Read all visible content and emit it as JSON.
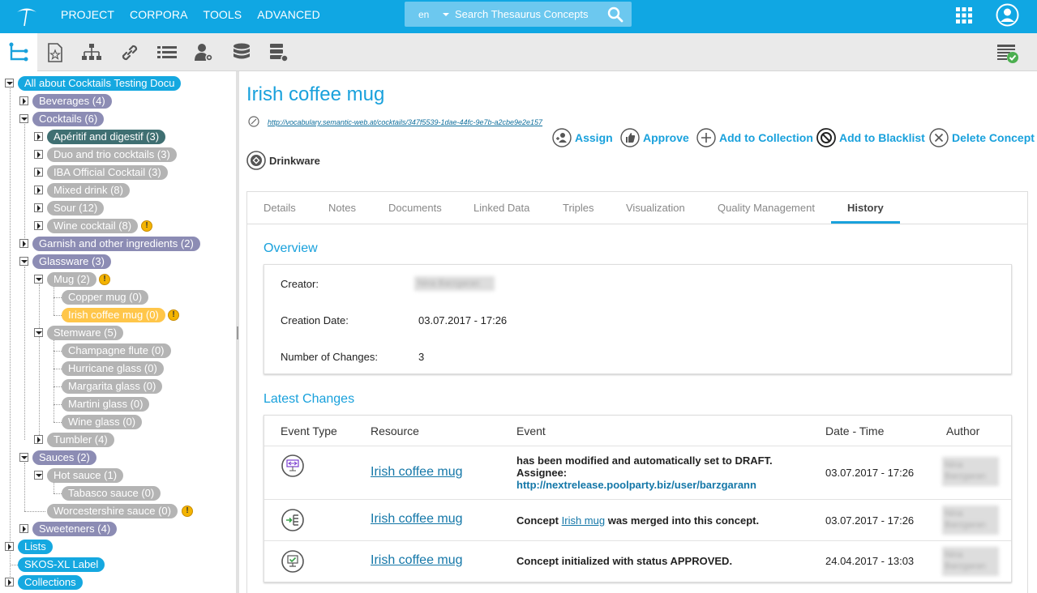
{
  "topbar": {
    "nav": [
      "PROJECT",
      "CORPORA",
      "TOOLS",
      "ADVANCED"
    ],
    "language": "en",
    "search_placeholder": "Search Thesaurus Concepts"
  },
  "tree": {
    "root": "All about Cocktails Testing Docu",
    "beverages": "Beverages (4)",
    "cocktails": "Cocktails (6)",
    "aperitif": "Apéritif and digestif (3)",
    "duo": "Duo and trio cocktails (3)",
    "iba": "IBA Official Cocktail (3)",
    "mixed": "Mixed drink (8)",
    "sour": "Sour (12)",
    "wine": "Wine cocktail (8)",
    "garnish": "Garnish and other ingredients (2)",
    "glassware": "Glassware (3)",
    "mug": "Mug (2)",
    "copper": "Copper mug (0)",
    "irish": "Irish coffee mug (0)",
    "stemware": "Stemware (5)",
    "champagne": "Champagne flute (0)",
    "hurricane": "Hurricane glass (0)",
    "margarita": "Margarita glass (0)",
    "martini": "Martini glass (0)",
    "wineglass": "Wine glass (0)",
    "tumbler": "Tumbler (4)",
    "sauces": "Sauces (2)",
    "hot": "Hot sauce (1)",
    "tabasco": "Tabasco sauce (0)",
    "worcester": "Worcestershire sauce (0)",
    "sweeteners": "Sweeteners (4)",
    "lists": "Lists",
    "skos": "SKOS-XL Label",
    "collections": "Collections",
    "warning_glyph": "!"
  },
  "concept": {
    "title": "Irish coffee mug",
    "uri": "http://vocabulary.semantic-web.at/cocktails/347f5539-1dae-44fc-9e7b-a2cbe9e2e157",
    "scheme": "Drinkware"
  },
  "actions": [
    "Assign",
    "Approve",
    "Add to Collection",
    "Add to Blacklist",
    "Delete Concept"
  ],
  "tabs": [
    "Details",
    "Notes",
    "Documents",
    "Linked Data",
    "Triples",
    "Visualization",
    "Quality Management",
    "History"
  ],
  "overview": {
    "title": "Overview",
    "creator_label": "Creator:",
    "creator_value": "Nina Barzgaran",
    "creation_date_label": "Creation Date:",
    "creation_date_value": "03.07.2017 - 17:26",
    "changes_label": "Number of Changes:",
    "changes_value": "3"
  },
  "latest_changes": {
    "title": "Latest Changes",
    "headers": [
      "Event Type",
      "Resource",
      "Event",
      "Date - Time",
      "Author"
    ],
    "rows": [
      {
        "resource": "Irish coffee mug",
        "event_line1": "has been modified and automatically set to DRAFT.",
        "event_line2": "Assignee:",
        "event_link": "http://nextrelease.poolparty.biz/user/barzgarann",
        "datetime": "03.07.2017 - 17:26",
        "author": "Nina Barzgaran"
      },
      {
        "resource": "Irish coffee mug",
        "event_pre": "Concept",
        "event_link": "Irish mug",
        "event_post": "was merged into this concept.",
        "datetime": "03.07.2017 - 17:26",
        "author": "Nina Barzgaran"
      },
      {
        "resource": "Irish coffee mug",
        "event": "Concept initialized with status APPROVED.",
        "datetime": "24.04.2017 - 13:03",
        "author": "Nina Barzgaran"
      }
    ]
  },
  "colors": {
    "brand": "#10a7e3",
    "link": "#19a1dc",
    "selected": "#ffc64a",
    "warning": "#f4b400"
  }
}
